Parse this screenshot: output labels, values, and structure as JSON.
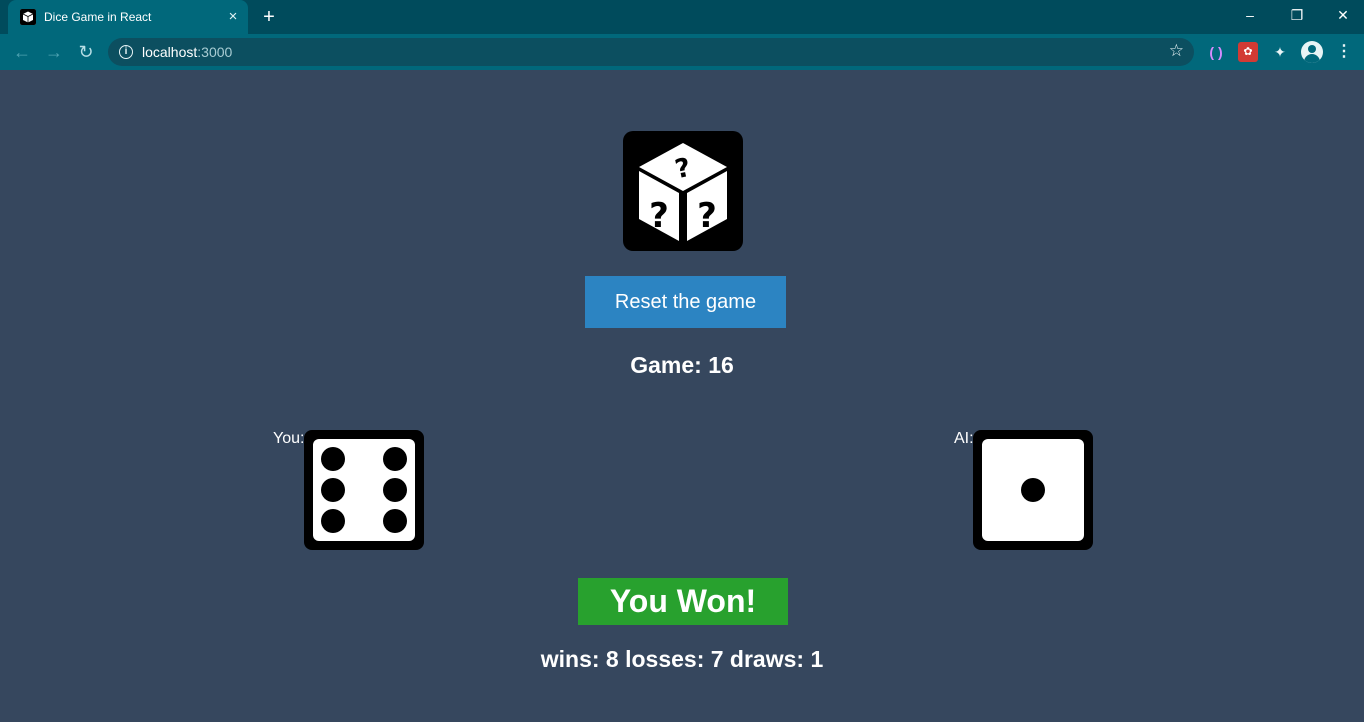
{
  "browser": {
    "tab_title": "Dice Game in React",
    "tab_close_icon": "×",
    "new_tab_icon": "+",
    "window_controls": {
      "minimize": "–",
      "restore": "❐",
      "close": "✕"
    },
    "nav": {
      "back": "←",
      "forward": "→",
      "reload": "↻"
    },
    "url_host": "localhost",
    "url_port": ":3000",
    "info_icon": "i",
    "bookmark_icon": "☆",
    "menu_icon": "⋮",
    "colors": {
      "tabbar": "#004b5c",
      "toolbar": "#01687b",
      "omnibox": "#0c4f60"
    }
  },
  "game": {
    "reset_label": "Reset the game",
    "game_counter": "Game: 16",
    "player_label": "You:",
    "ai_label": "AI:",
    "player_die_value": 6,
    "ai_die_value": 1,
    "result": "You Won!",
    "stats": "wins: 8 losses: 7 draws: 1",
    "colors": {
      "background": "#36475e",
      "button": "#2c84c2",
      "result": "#28a12e"
    }
  }
}
